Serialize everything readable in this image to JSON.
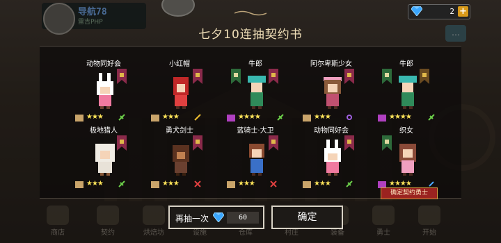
{
  "hud": {
    "player_name": "导航78",
    "player_sub": "雷吉PHP",
    "gems": "2"
  },
  "dialog": {
    "title": "七夕10连抽契约书",
    "confirm_tag": "确定契约勇士",
    "redraw_label": "再抽一次",
    "redraw_cost": "60",
    "confirm_label": "确定"
  },
  "heroes": [
    {
      "name": "动物同好会",
      "stars": "★★★"
    },
    {
      "name": "小红帽",
      "stars": "★★★"
    },
    {
      "name": "牛郎",
      "stars": "★★★★"
    },
    {
      "name": "阿尔卑斯少女",
      "stars": "★★★"
    },
    {
      "name": "牛郎",
      "stars": "★★★★"
    },
    {
      "name": "极地猎人",
      "stars": "★★★"
    },
    {
      "name": "勇犬剑士",
      "stars": "★★★"
    },
    {
      "name": "蓝骑士·大卫",
      "stars": "★★★"
    },
    {
      "name": "动物同好会",
      "stars": "★★★"
    },
    {
      "name": "织女",
      "stars": "★★★★"
    }
  ],
  "nav": [
    {
      "label": "商店"
    },
    {
      "label": "契约"
    },
    {
      "label": "烘焙坊"
    },
    {
      "label": "设施"
    },
    {
      "label": "仓库"
    },
    {
      "label": "村庄"
    },
    {
      "label": "装备"
    },
    {
      "label": "勇士"
    },
    {
      "label": "开始"
    }
  ],
  "colors": {
    "star": "#ffe45a",
    "banner": "#8a2a4a",
    "accent_button": "#d89a1a"
  }
}
